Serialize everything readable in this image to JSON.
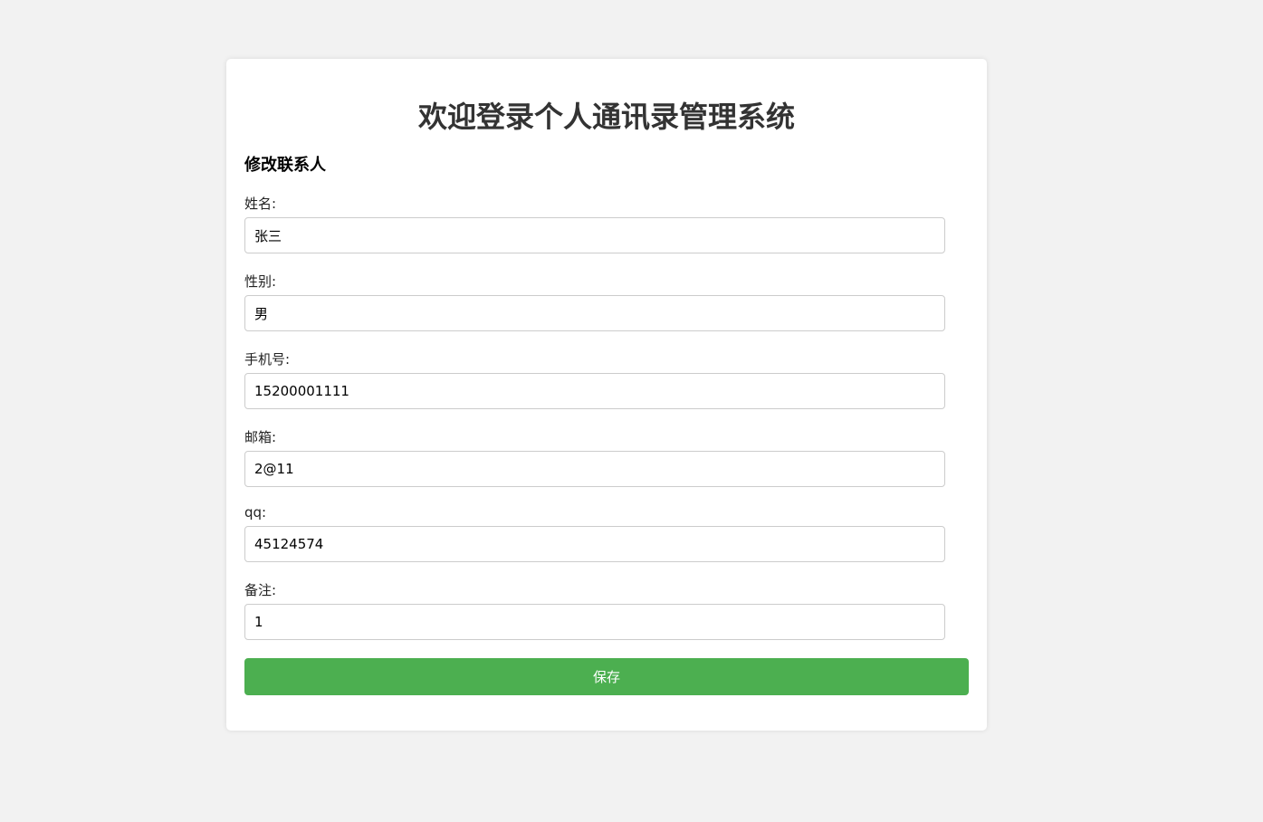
{
  "header": {
    "title": "欢迎登录个人通讯录管理系统"
  },
  "form": {
    "section_title": "修改联系人",
    "fields": [
      {
        "label": "姓名:",
        "value": "张三"
      },
      {
        "label": "性别:",
        "value": "男"
      },
      {
        "label": "手机号:",
        "value": "15200001111"
      },
      {
        "label": "邮箱:",
        "value": "2@11"
      },
      {
        "label": "qq:",
        "value": "45124574"
      },
      {
        "label": "备注:",
        "value": "1"
      }
    ],
    "save_label": "保存"
  },
  "colors": {
    "background": "#f2f2f2",
    "card": "#ffffff",
    "accent": "#4caf50",
    "title_text": "#333333"
  }
}
